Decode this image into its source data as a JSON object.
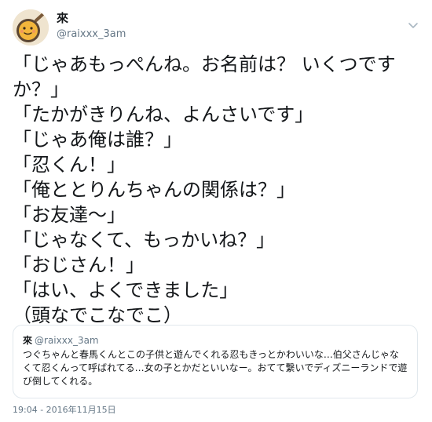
{
  "author": {
    "display_name": "來",
    "screen_name": "@raixxx_3am"
  },
  "tweet": {
    "lines": [
      "「じゃあもっぺんね。お名前は？ いくつですか？」",
      "「たかがきりんね、よんさいです」",
      "「じゃあ俺は誰？」",
      "「忍くん！」",
      "「俺ととりんちゃんの関係は？」",
      "「お友達〜」",
      "「じゃなくて、もっかいね？」",
      "「おじさん！」",
      "「はい、よくできました」",
      "（頭なでこなでこ）"
    ]
  },
  "quoted_tweet": {
    "display_name": "來",
    "screen_name": "@raixxx_3am",
    "text": "つぐちゃんと春馬くんとこの子供と遊んでくれる忍もきっとかわいいな…伯父さんじゃなくて忍くんって呼ばれてる…女の子とかだといいなー。おてて繋いでディズニーランドで遊び倒してくれる。"
  },
  "timestamp": "19:04 - 2016年11月15日",
  "icons": {
    "avatar": "avatar-pan-icon",
    "menu": "chevron-down-icon"
  },
  "colors": {
    "text": "#14171a",
    "secondary": "#657786",
    "border": "#e1e8ed"
  }
}
